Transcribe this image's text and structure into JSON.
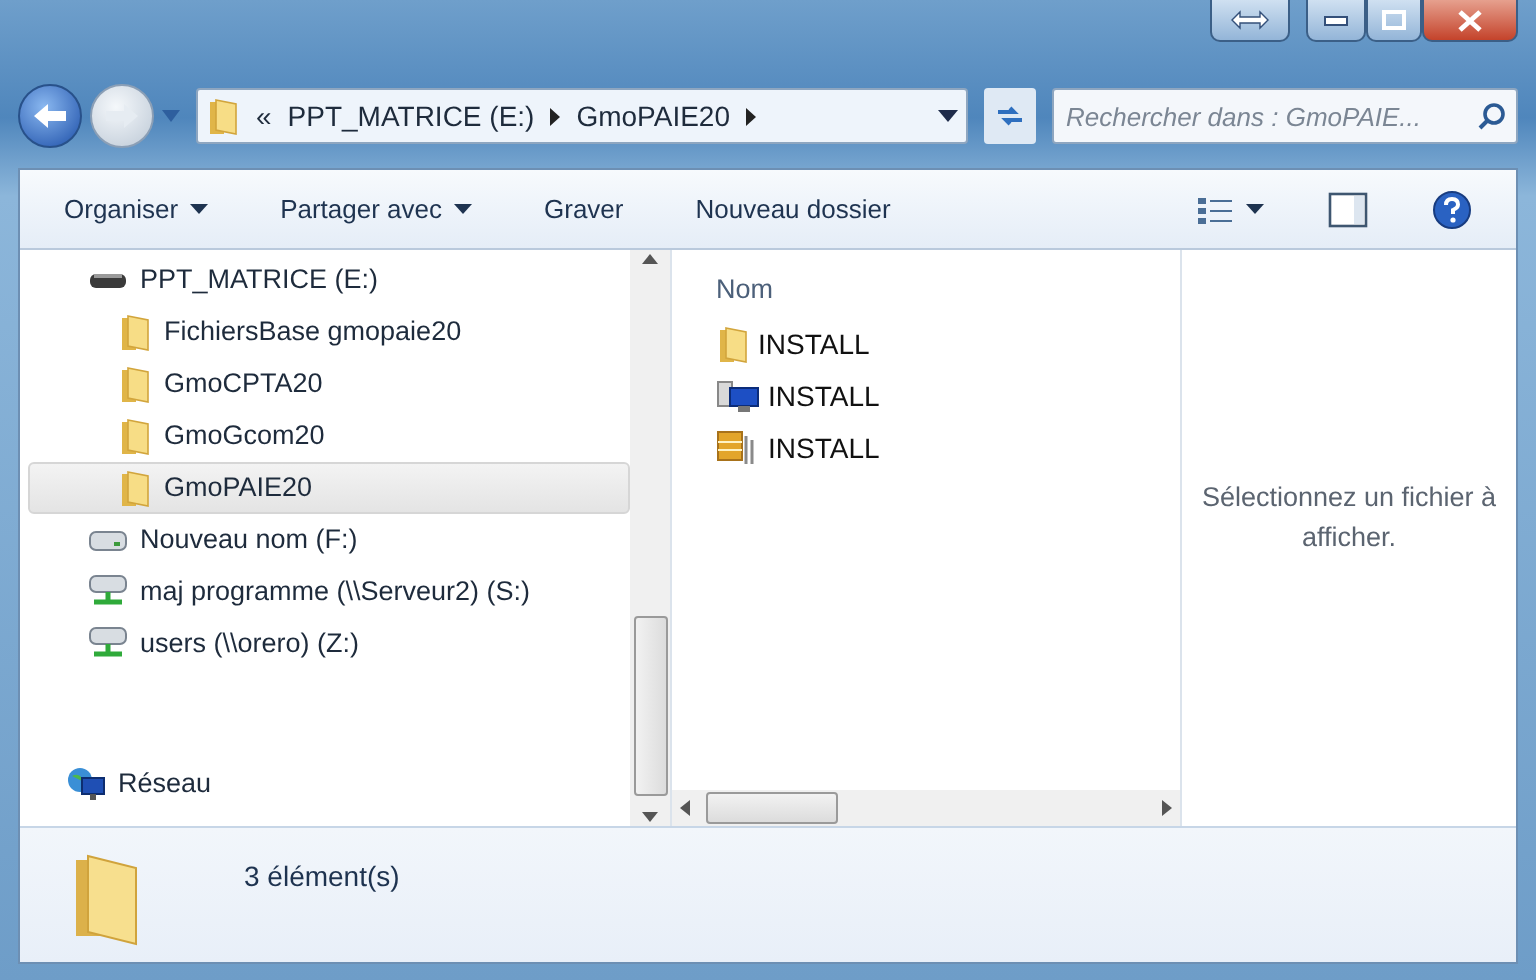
{
  "address": {
    "crumbs": [
      {
        "label": "«",
        "kind": "overflow"
      },
      {
        "label": "PPT_MATRICE (E:)",
        "kind": "crumb"
      },
      {
        "label": "GmoPAIE20",
        "kind": "crumb"
      }
    ]
  },
  "search": {
    "placeholder": "Rechercher dans : GmoPAIE..."
  },
  "toolbar": [
    {
      "label": "Organiser",
      "dropdown": true
    },
    {
      "label": "Partager avec",
      "dropdown": true
    },
    {
      "label": "Graver",
      "dropdown": false
    },
    {
      "label": "Nouveau dossier",
      "dropdown": false
    }
  ],
  "nav": [
    {
      "label": "PPT_MATRICE (E:)",
      "kind": "drive",
      "selected": false,
      "children": [
        {
          "label": "FichiersBase gmopaie20",
          "kind": "folder",
          "selected": false
        },
        {
          "label": "GmoCPTA20",
          "kind": "folder",
          "selected": false
        },
        {
          "label": "GmoGcom20",
          "kind": "folder",
          "selected": false
        },
        {
          "label": "GmoPAIE20",
          "kind": "folder",
          "selected": true
        }
      ]
    },
    {
      "label": "Nouveau nom (F:)",
      "kind": "drive2",
      "selected": false
    },
    {
      "label": "maj programme (\\\\Serveur2) (S:)",
      "kind": "netdrive",
      "selected": false
    },
    {
      "label": "users (\\\\orero) (Z:)",
      "kind": "netdrive",
      "selected": false
    },
    {
      "label": "Réseau",
      "kind": "network",
      "selected": false
    }
  ],
  "files": {
    "columns": [
      "Nom"
    ],
    "rows": [
      {
        "name": "INSTALL",
        "kind": "folder"
      },
      {
        "name": "INSTALL",
        "kind": "setup"
      },
      {
        "name": "INSTALL",
        "kind": "package"
      }
    ]
  },
  "preview": {
    "message": "Sélectionnez un fichier à afficher."
  },
  "status_bar": {
    "count": "3 élément(s)"
  }
}
